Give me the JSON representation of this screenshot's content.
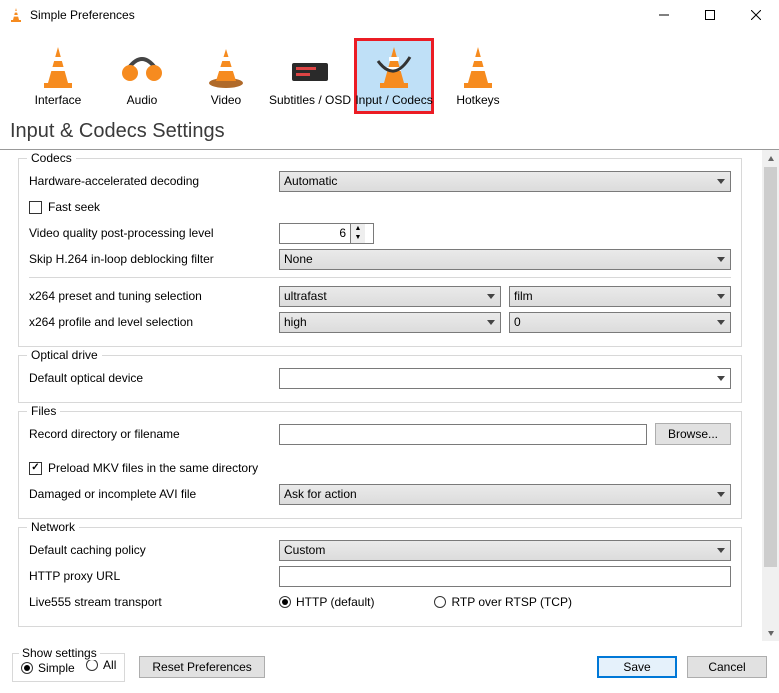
{
  "window": {
    "title": "Simple Preferences"
  },
  "tabs": [
    {
      "label": "Interface"
    },
    {
      "label": "Audio"
    },
    {
      "label": "Video"
    },
    {
      "label": "Subtitles / OSD"
    },
    {
      "label": "Input / Codecs"
    },
    {
      "label": "Hotkeys"
    }
  ],
  "page_title": "Input & Codecs Settings",
  "codecs": {
    "legend": "Codecs",
    "hw_label": "Hardware-accelerated decoding",
    "hw_value": "Automatic",
    "fast_seek_label": "Fast seek",
    "fast_seek_checked": false,
    "pp_label": "Video quality post-processing level",
    "pp_value": "6",
    "skip_label": "Skip H.264 in-loop deblocking filter",
    "skip_value": "None",
    "preset_label": "x264 preset and tuning selection",
    "preset_value": "ultrafast",
    "tuning_value": "film",
    "profile_label": "x264 profile and level selection",
    "profile_value": "high",
    "level_value": "0"
  },
  "optical": {
    "legend": "Optical drive",
    "default_label": "Default optical device",
    "default_value": ""
  },
  "files": {
    "legend": "Files",
    "record_label": "Record directory or filename",
    "record_value": "",
    "browse_label": "Browse...",
    "preload_label": "Preload MKV files in the same directory",
    "preload_checked": true,
    "avi_label": "Damaged or incomplete AVI file",
    "avi_value": "Ask for action"
  },
  "network": {
    "legend": "Network",
    "caching_label": "Default caching policy",
    "caching_value": "Custom",
    "proxy_label": "HTTP proxy URL",
    "proxy_value": "",
    "live555_label": "Live555 stream transport",
    "live555_http": "HTTP (default)",
    "live555_rtsp": "RTP over RTSP (TCP)"
  },
  "footer": {
    "show_settings_legend": "Show settings",
    "simple_label": "Simple",
    "all_label": "All",
    "reset_label": "Reset Preferences",
    "save_label": "Save",
    "cancel_label": "Cancel"
  }
}
